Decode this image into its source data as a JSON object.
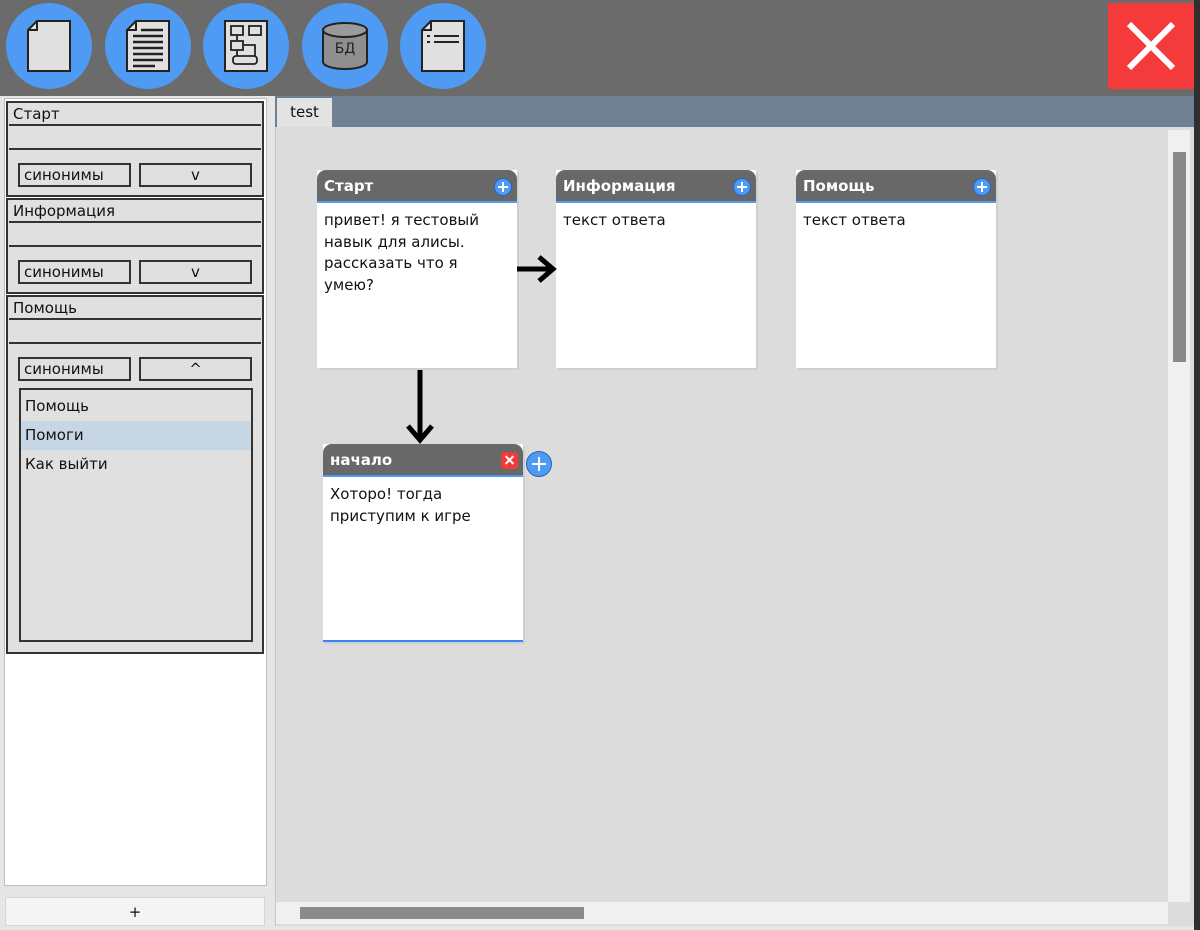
{
  "toolbar": {
    "buttons": [
      {
        "icon": "new-file-icon"
      },
      {
        "icon": "document-text-icon"
      },
      {
        "icon": "flowchart-icon"
      },
      {
        "icon": "database-icon",
        "label": "БД"
      },
      {
        "icon": "settings-document-icon"
      }
    ],
    "close_icon": "close-icon",
    "colors": {
      "button": "#4f9bf4",
      "close": "#f43a3a",
      "bar": "#6b6b6b"
    }
  },
  "sidebar": {
    "intents": [
      {
        "name": "Старт",
        "value": "",
        "synonyms_label": "синонимы",
        "toggle": "v",
        "expanded": false
      },
      {
        "name": "Информация",
        "value": "",
        "synonyms_label": "синонимы",
        "toggle": "v",
        "expanded": false
      },
      {
        "name": "Помощь",
        "value": "",
        "synonyms_label": "синонимы",
        "toggle": "^",
        "expanded": true,
        "synonyms": [
          "Помощь",
          "Помоги",
          "Как выйти"
        ],
        "selected_synonym": "Помоги"
      }
    ],
    "add_button": "+"
  },
  "tabs": [
    {
      "label": "test",
      "active": true
    }
  ],
  "canvas": {
    "nodes": [
      {
        "title": "Старт",
        "text": "привет! я тестовый навык для алисы. рассказать что я умею?"
      },
      {
        "title": "Информация",
        "text": "текст ответа"
      },
      {
        "title": "Помощь",
        "text": "текст ответа"
      },
      {
        "title": "начало",
        "text": "Хоторо! тогда приступим к игре"
      }
    ]
  }
}
